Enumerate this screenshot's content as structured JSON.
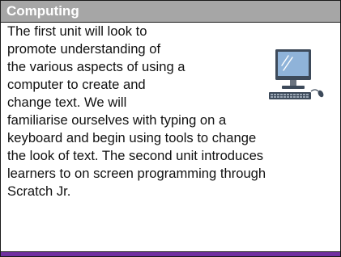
{
  "header": {
    "title": "Computing"
  },
  "body": {
    "lines": [
      "The first unit will look to",
      "promote understanding of",
      "the various aspects of using a",
      "computer to create and",
      "change text. We will",
      "familiarise ourselves with typing on a",
      "keyboard and begin using tools to change",
      "the look of text. The second unit introduces",
      "learners to on screen programming through",
      "Scratch Jr."
    ]
  },
  "icon": {
    "name": "desktop-computer-icon"
  },
  "colors": {
    "header_bg": "#a6a6a6",
    "header_text": "#ffffff",
    "accent_bar": "#7030a0",
    "monitor": "#3d4a5a",
    "screen": "#8fb3d9"
  }
}
